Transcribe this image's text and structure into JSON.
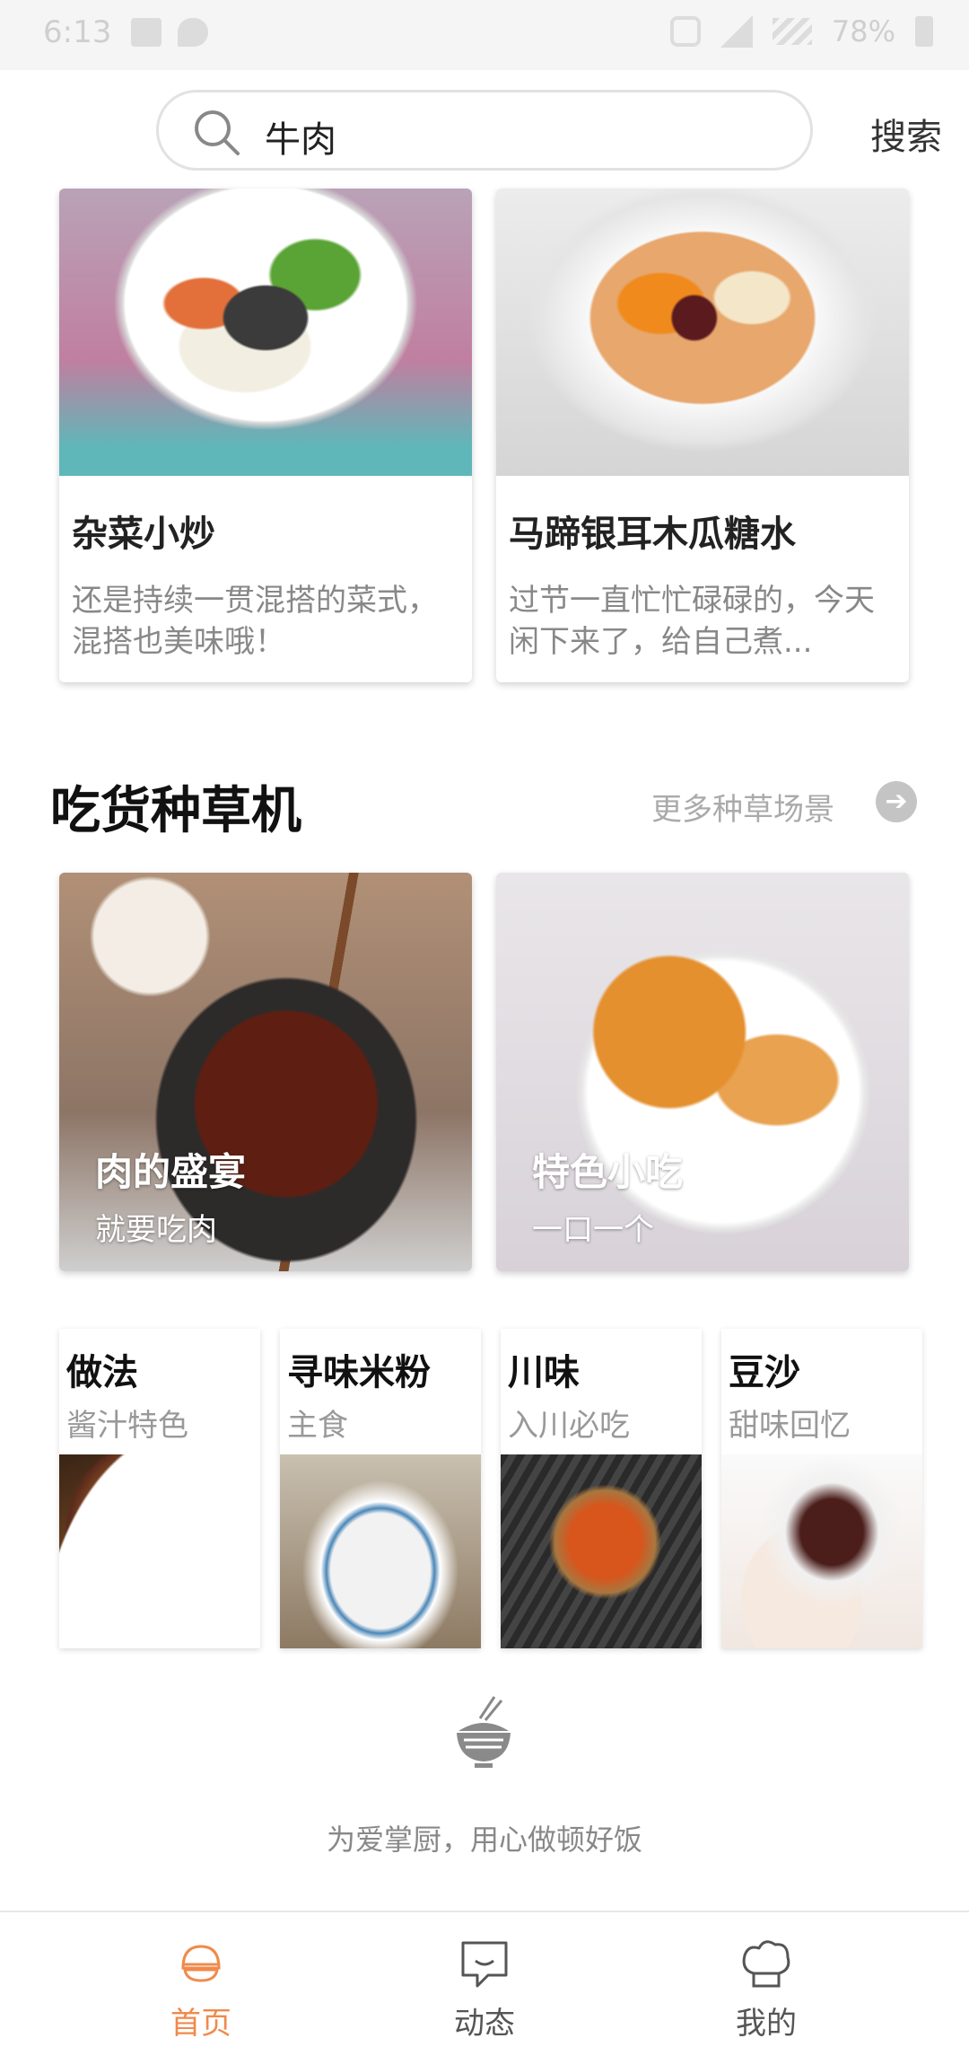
{
  "status_bar": {
    "time": "6:13",
    "battery": "78%"
  },
  "search": {
    "value": "牛肉",
    "button_label": "搜索"
  },
  "recipes": [
    {
      "title": "杂菜小炒",
      "desc": "还是持续一贯混搭的菜式，混搭也美味哦！"
    },
    {
      "title": "马蹄银耳木瓜糖水",
      "desc": "过节一直忙忙碌碌的，今天闲下来了，给自己煮..."
    }
  ],
  "section": {
    "title": "吃货种草机",
    "more_label": "更多种草场景"
  },
  "features": [
    {
      "title": "肉的盛宴",
      "subtitle": "就要吃肉"
    },
    {
      "title": "特色小吃",
      "subtitle": "一口一个"
    }
  ],
  "categories": [
    {
      "title": "做法",
      "subtitle": "酱汁特色"
    },
    {
      "title": "寻味米粉",
      "subtitle": "主食"
    },
    {
      "title": "川味",
      "subtitle": "入川必吃"
    },
    {
      "title": "豆沙",
      "subtitle": "甜味回忆"
    }
  ],
  "footer": {
    "slogan": "为爱掌厨，用心做顿好饭"
  },
  "nav": {
    "items": [
      {
        "label": "首页",
        "icon": "chef-hat-home-icon",
        "active": true
      },
      {
        "label": "动态",
        "icon": "chat-bubble-icon",
        "active": false
      },
      {
        "label": "我的",
        "icon": "chef-hat-profile-icon",
        "active": false
      }
    ],
    "active_color": "#f08a4b",
    "inactive_color": "#555555"
  }
}
